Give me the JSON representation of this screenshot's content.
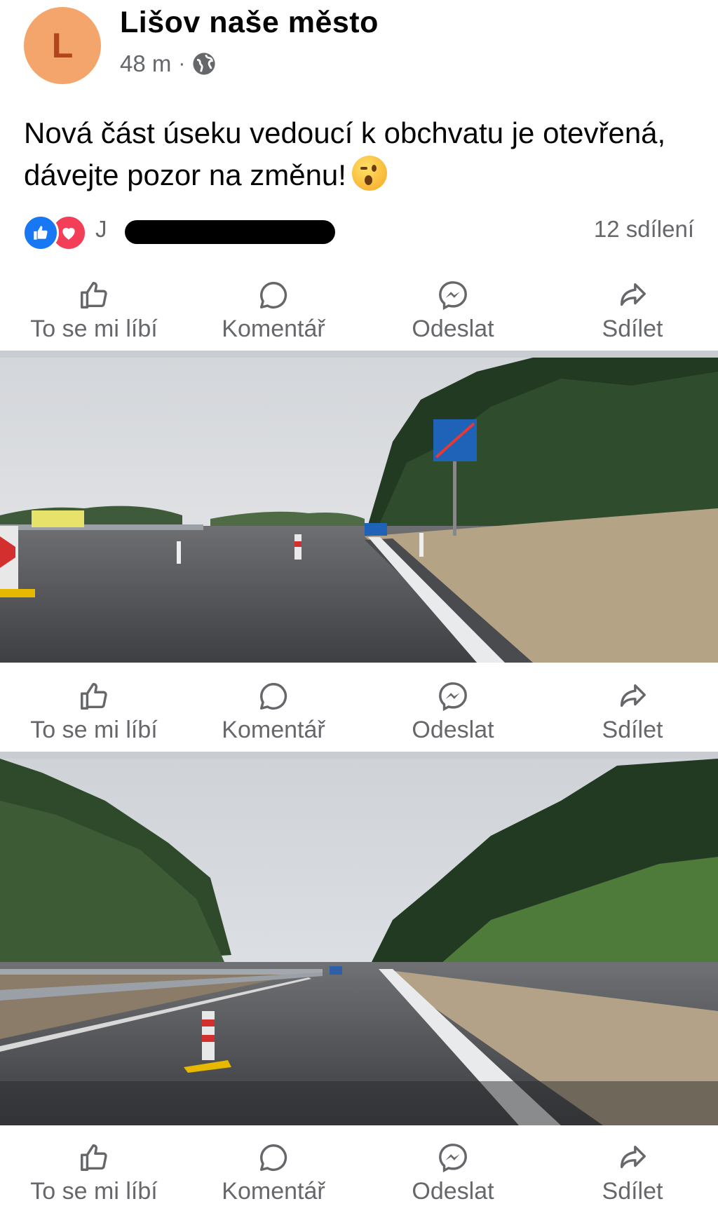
{
  "post": {
    "page_name": "Lišov naše město",
    "avatar_letter": "L",
    "time": "48 m",
    "separator": "·",
    "text": "Nová část úseku vedoucí k obchvatu je otevřená, dávejte pozor na změnu!"
  },
  "reactions": {
    "name_initial": "J",
    "shares": "12 sdílení"
  },
  "actions": {
    "like": "To se mi líbí",
    "comment": "Komentář",
    "send": "Odeslat",
    "share": "Sdílet"
  },
  "colors": {
    "avatar_bg": "#f4a56b",
    "like_blue": "#1877f2",
    "love_red": "#f33e58",
    "secondary_text": "#65676b",
    "divider": "#c9ccd1"
  }
}
